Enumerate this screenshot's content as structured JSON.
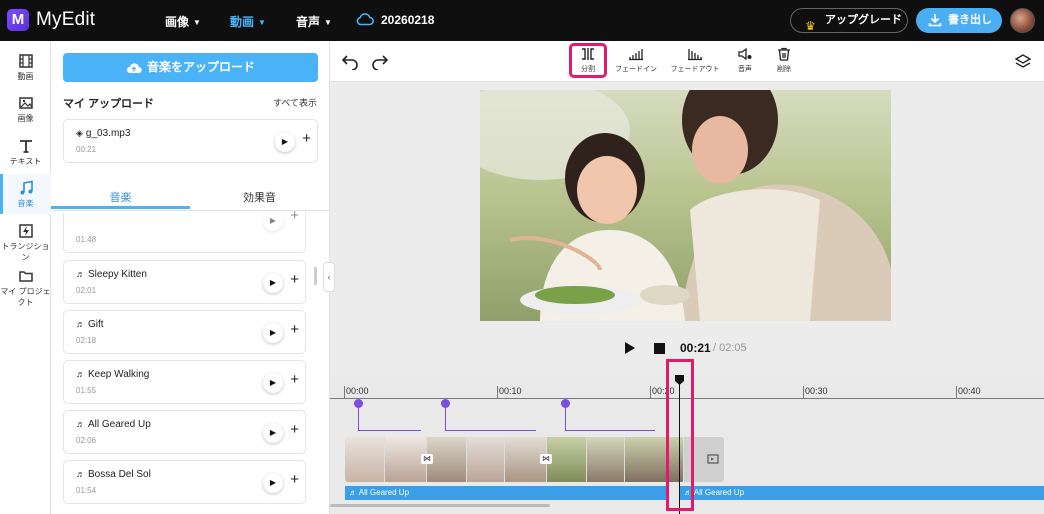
{
  "app": {
    "logo_letter": "M",
    "name": "MyEdit"
  },
  "nav": [
    {
      "label": "画像",
      "active": false
    },
    {
      "label": "動画",
      "active": true
    },
    {
      "label": "音声",
      "active": false
    }
  ],
  "project_name": "20260218",
  "header": {
    "upgrade_label": "アップグレード",
    "export_label": "書き出し"
  },
  "rail": [
    {
      "label": "動画",
      "icon": "film-icon"
    },
    {
      "label": "画像",
      "icon": "image-icon"
    },
    {
      "label": "テキスト",
      "icon": "text-icon"
    },
    {
      "label": "音楽",
      "icon": "music-note-icon",
      "active": true
    },
    {
      "label": "トランジション",
      "icon": "transition-icon"
    },
    {
      "label": "マイ プロジェクト",
      "icon": "folder-icon"
    }
  ],
  "panel": {
    "upload_label": "音楽をアップロード",
    "my_upload_title": "マイ アップロード",
    "show_all": "すべて表示",
    "uploads": [
      {
        "name": "g_03.mp3",
        "duration": "00:21"
      }
    ],
    "tabs": [
      {
        "label": "音楽",
        "active": true
      },
      {
        "label": "効果音",
        "active": false
      }
    ],
    "tracks": [
      {
        "name": "",
        "duration": "01:48"
      },
      {
        "name": "Sleepy Kitten",
        "duration": "02:01"
      },
      {
        "name": "Gift",
        "duration": "02:18"
      },
      {
        "name": "Keep Walking",
        "duration": "01:55"
      },
      {
        "name": "All Geared Up",
        "duration": "02:06"
      },
      {
        "name": "Bossa Del Sol",
        "duration": "01:54"
      }
    ]
  },
  "toolbar": {
    "tools": [
      {
        "label": "分割",
        "icon": "split-icon",
        "highlighted": true
      },
      {
        "label": "フェードイン",
        "icon": "fade-in-icon"
      },
      {
        "label": "フェードアウト",
        "icon": "fade-out-icon"
      },
      {
        "label": "音声",
        "icon": "volume-icon"
      },
      {
        "label": "削除",
        "icon": "trash-icon"
      }
    ]
  },
  "player": {
    "current_time": "00:21",
    "total_time": "/ 02:05"
  },
  "timeline": {
    "ticks": [
      "00:00",
      "00:10",
      "00:20",
      "00:30",
      "00:40"
    ],
    "audio_clip_left": "All Geared Up",
    "audio_clip_right": "All Geared Up"
  },
  "colors": {
    "accent": "#4ab3f7",
    "highlight": "#e3186f",
    "transition": "#7c4ddf",
    "topbar": "#0f0f0f"
  }
}
